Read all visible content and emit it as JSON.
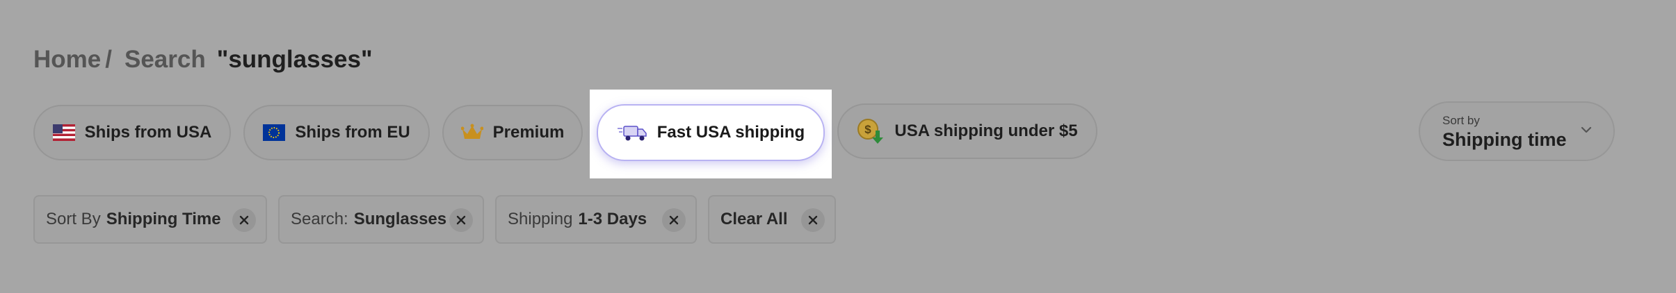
{
  "breadcrumb": {
    "home": "Home",
    "separator": "/",
    "search_label": "Search",
    "query": "\"sunglasses\""
  },
  "filters": [
    {
      "label": "Ships from USA",
      "icon": "us-flag-icon",
      "active": false
    },
    {
      "label": "Ships from EU",
      "icon": "eu-flag-icon",
      "active": false
    },
    {
      "label": "Premium",
      "icon": "crown-icon",
      "active": false
    },
    {
      "label": "Fast USA shipping",
      "icon": "fast-truck-icon",
      "active": true
    },
    {
      "label": "USA shipping under $5",
      "icon": "coin-down-arrow-icon",
      "active": false
    }
  ],
  "sort": {
    "label": "Sort by",
    "value": "Shipping time",
    "icon": "chevron-down-icon"
  },
  "applied_filters": [
    {
      "prefix": "Sort By",
      "value": "Shipping Time"
    },
    {
      "prefix": "Search:",
      "value": "Sunglasses"
    },
    {
      "prefix": "Shipping",
      "value": "1-3 Days"
    },
    {
      "prefix": "",
      "value": "Clear All"
    }
  ],
  "colors": {
    "overlay_bg": "#a6a6a6",
    "active_chip_bg": "#ffffff",
    "active_chip_border": "#b8b2f2",
    "crown": "#c8901f",
    "coin": "#c9a23a",
    "arrow": "#2e8b3a"
  }
}
